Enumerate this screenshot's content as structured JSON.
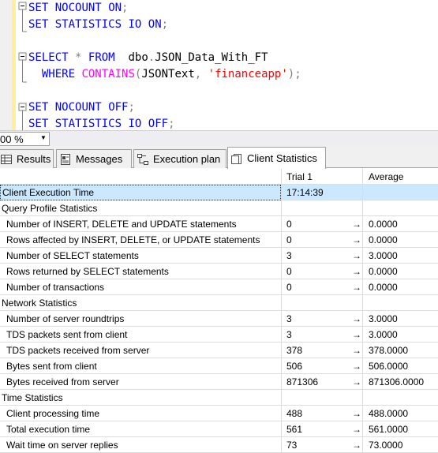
{
  "editor": {
    "lines": [
      [
        {
          "t": "SET",
          "c": "kw"
        },
        {
          "t": " ",
          "c": "id"
        },
        {
          "t": "NOCOUNT",
          "c": "kw"
        },
        {
          "t": " ",
          "c": "id"
        },
        {
          "t": "ON",
          "c": "kw"
        },
        {
          "t": ";",
          "c": "op"
        }
      ],
      [
        {
          "t": "SET",
          "c": "kw"
        },
        {
          "t": " ",
          "c": "id"
        },
        {
          "t": "STATISTICS",
          "c": "kw"
        },
        {
          "t": " ",
          "c": "id"
        },
        {
          "t": "IO",
          "c": "kw"
        },
        {
          "t": " ",
          "c": "id"
        },
        {
          "t": "ON",
          "c": "kw"
        },
        {
          "t": ";",
          "c": "op"
        }
      ],
      [],
      [
        {
          "t": "SELECT",
          "c": "kw"
        },
        {
          "t": " ",
          "c": "id"
        },
        {
          "t": "*",
          "c": "op"
        },
        {
          "t": " ",
          "c": "id"
        },
        {
          "t": "FROM",
          "c": "kw"
        },
        {
          "t": "  dbo",
          "c": "id"
        },
        {
          "t": ".",
          "c": "op"
        },
        {
          "t": "JSON_Data_With_FT",
          "c": "id"
        }
      ],
      [
        {
          "t": "  ",
          "c": "id"
        },
        {
          "t": "WHERE",
          "c": "kw"
        },
        {
          "t": " ",
          "c": "id"
        },
        {
          "t": "CONTAINS",
          "c": "fn"
        },
        {
          "t": "(",
          "c": "op"
        },
        {
          "t": "JSONText",
          "c": "id"
        },
        {
          "t": ",",
          "c": "op"
        },
        {
          "t": " ",
          "c": "id"
        },
        {
          "t": "'financeapp'",
          "c": "str"
        },
        {
          "t": ");",
          "c": "op"
        }
      ],
      [],
      [
        {
          "t": "SET",
          "c": "kw"
        },
        {
          "t": " ",
          "c": "id"
        },
        {
          "t": "NOCOUNT",
          "c": "kw"
        },
        {
          "t": " ",
          "c": "id"
        },
        {
          "t": "OFF",
          "c": "kw"
        },
        {
          "t": ";",
          "c": "op"
        }
      ],
      [
        {
          "t": "SET",
          "c": "kw"
        },
        {
          "t": " ",
          "c": "id"
        },
        {
          "t": "STATISTICS",
          "c": "kw"
        },
        {
          "t": " ",
          "c": "id"
        },
        {
          "t": "IO",
          "c": "kw"
        },
        {
          "t": " ",
          "c": "id"
        },
        {
          "t": "OFF",
          "c": "kw"
        },
        {
          "t": ";",
          "c": "op"
        }
      ]
    ]
  },
  "zoom": {
    "value": "00 %"
  },
  "tabs": [
    {
      "label": "Results",
      "icon": "grid-icon",
      "active": false
    },
    {
      "label": "Messages",
      "icon": "messages-icon",
      "active": false
    },
    {
      "label": "Execution plan",
      "icon": "execution-plan-icon",
      "active": false
    },
    {
      "label": "Client Statistics",
      "icon": "client-statistics-icon",
      "active": true
    }
  ],
  "grid": {
    "headers": {
      "name": "",
      "trial": "Trial  1",
      "average": "Average"
    },
    "rows": [
      {
        "type": "item-selected",
        "name": "Client Execution Time",
        "trial": "17:14:39",
        "arrow": "",
        "average": ""
      },
      {
        "type": "section",
        "name": "Query Profile Statistics"
      },
      {
        "type": "item",
        "name": "Number of INSERT, DELETE and UPDATE statements",
        "trial": "0",
        "arrow": "→",
        "average": "0.0000"
      },
      {
        "type": "item",
        "name": "Rows affected by INSERT, DELETE, or UPDATE statements",
        "trial": "0",
        "arrow": "→",
        "average": "0.0000"
      },
      {
        "type": "item",
        "name": "Number of SELECT statements",
        "trial": "3",
        "arrow": "→",
        "average": "3.0000"
      },
      {
        "type": "item",
        "name": "Rows returned by SELECT statements",
        "trial": "0",
        "arrow": "→",
        "average": "0.0000"
      },
      {
        "type": "item",
        "name": "Number of transactions",
        "trial": "0",
        "arrow": "→",
        "average": "0.0000"
      },
      {
        "type": "section",
        "name": "Network Statistics"
      },
      {
        "type": "item",
        "name": "Number of server roundtrips",
        "trial": "3",
        "arrow": "→",
        "average": "3.0000"
      },
      {
        "type": "item",
        "name": "TDS packets sent from client",
        "trial": "3",
        "arrow": "→",
        "average": "3.0000"
      },
      {
        "type": "item",
        "name": "TDS packets received from server",
        "trial": "378",
        "arrow": "→",
        "average": "378.0000"
      },
      {
        "type": "item",
        "name": "Bytes sent from client",
        "trial": "506",
        "arrow": "→",
        "average": "506.0000"
      },
      {
        "type": "item",
        "name": "Bytes received from server",
        "trial": "871306",
        "arrow": "→",
        "average": "871306.0000"
      },
      {
        "type": "section",
        "name": "Time Statistics"
      },
      {
        "type": "item",
        "name": "Client processing time",
        "trial": "488",
        "arrow": "→",
        "average": "488.0000"
      },
      {
        "type": "item",
        "name": "Total execution time",
        "trial": "561",
        "arrow": "→",
        "average": "561.0000"
      },
      {
        "type": "item",
        "name": "Wait time on server replies",
        "trial": "73",
        "arrow": "→",
        "average": "73.0000"
      }
    ]
  },
  "colors": {
    "selection": "#cce8ff",
    "keyword": "#0000ff",
    "string": "#ff0000",
    "function": "#ff00ff",
    "change_bar": "#ffef9c"
  }
}
